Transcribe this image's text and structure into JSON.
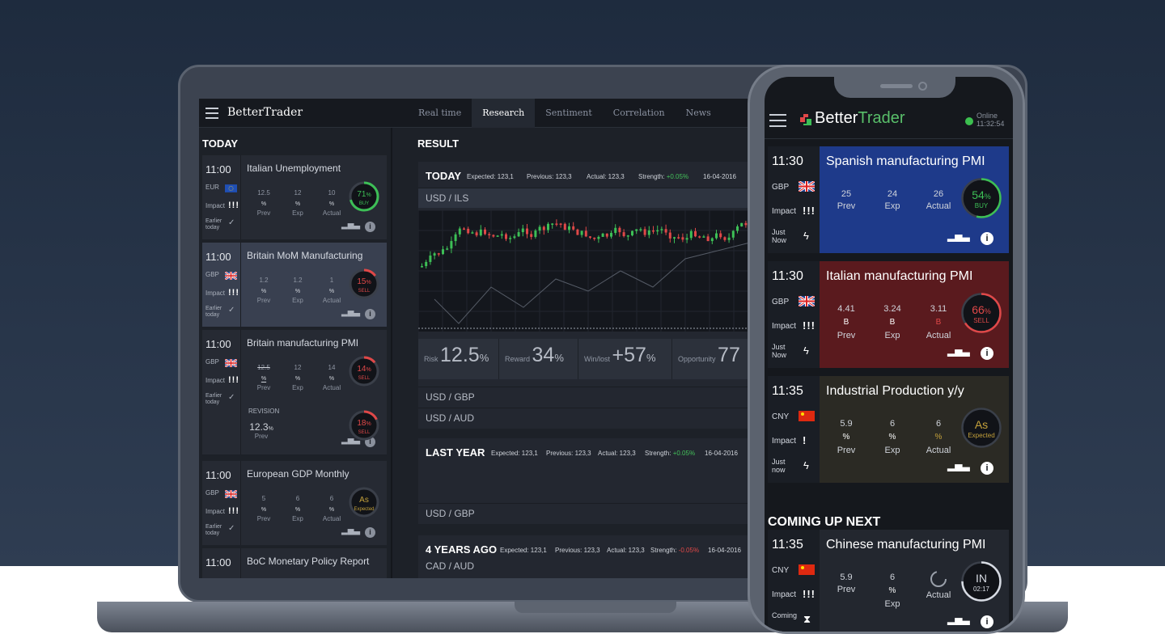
{
  "colors": {
    "buy": "#3dbf56",
    "sell": "#e04848",
    "expected": "#c4a13b",
    "card_blue": "#1e3a8a",
    "card_red": "#5a1a1e",
    "card_olive": "#2b2a24"
  },
  "desktop": {
    "logo": "BetterTrader",
    "tabs": [
      "Real time",
      "Research",
      "Sentiment",
      "Correlation",
      "News"
    ],
    "active_tab": "Research",
    "today_label": "TODAY",
    "result_label": "RESULT",
    "events": [
      {
        "time": "11:00",
        "currency": "EUR",
        "flag": "eu",
        "impact_label": "Impact",
        "impact": "!!!",
        "earlier": "Earlier today",
        "check": "✓",
        "title": "Italian Unemployment",
        "prev": "12.5",
        "exp": "12",
        "actual": "10",
        "unit": "%",
        "prev_label": "Prev",
        "exp_label": "Exp",
        "actual_label": "Actual",
        "ring_value": "71",
        "ring_unit": "%",
        "ring_label": "BUY",
        "ring_kind": "buy",
        "ring_fraction": 0.71
      },
      {
        "time": "11:00",
        "currency": "GBP",
        "flag": "uk",
        "impact_label": "Impact",
        "impact": "!!!",
        "earlier": "Earlier today",
        "check": "✓",
        "title": "Britain MoM Manufacturing",
        "prev": "1.2",
        "exp": "1.2",
        "actual": "1",
        "unit": "%",
        "prev_label": "Prev",
        "exp_label": "Exp",
        "actual_label": "Actual",
        "ring_value": "15",
        "ring_unit": "%",
        "ring_label": "SELL",
        "ring_kind": "sell",
        "ring_fraction": 0.15
      },
      {
        "time": "11:00",
        "currency": "GBP",
        "flag": "uk",
        "impact_label": "Impact",
        "impact": "!!!",
        "earlier": "Earlier today",
        "check": "✓",
        "title": "Britain manufacturing PMI",
        "prev": "12.5",
        "exp": "12",
        "actual": "14",
        "unit": "%",
        "prev_label": "Prev",
        "exp_label": "Exp",
        "actual_label": "Actual",
        "ring_value": "14",
        "ring_unit": "%",
        "ring_label": "SELL",
        "ring_kind": "sell",
        "ring_fraction": 0.14,
        "revision_label": "REVISION",
        "revision_prev": "12.3",
        "revision_ring_value": "18",
        "revision_ring_label": "SELL",
        "revision_ring_fraction": 0.18
      },
      {
        "time": "11:00",
        "currency": "GBP",
        "flag": "uk",
        "impact_label": "Impact",
        "impact": "!!!",
        "earlier": "Earlier today",
        "check": "✓",
        "title": "European GDP Monthly",
        "prev": "5",
        "exp": "6",
        "actual": "6",
        "unit": "%",
        "prev_label": "Prev",
        "exp_label": "Exp",
        "actual_label": "Actual",
        "ring_value": "As",
        "ring_label": "Expected",
        "ring_kind": "expected",
        "ring_fraction": 0
      },
      {
        "time": "11:00",
        "title": "BoC Monetary Policy Report"
      }
    ],
    "today_panel": {
      "title": "TODAY",
      "expected": "Expected: 123,1",
      "previous": "Previous: 123,3",
      "actual": "Actual: 123,3",
      "strength_label": "Strength:",
      "strength": "+0.05%",
      "date": "16-04-2016",
      "pair": "USD / ILS",
      "risk_label": "Risk",
      "risk": "12.5",
      "reward_label": "Reward",
      "reward": "34",
      "winlost_label": "Win/lost",
      "winlost": "+57",
      "opportunity_label": "Opportunity",
      "opportunity": "77",
      "pct": "%",
      "pairs": [
        "USD / GBP",
        "USD / AUD"
      ]
    },
    "last_year_panel": {
      "title": "LAST YEAR",
      "expected": "Expected: 123,1",
      "previous": "Previous: 123,3",
      "actual": "Actual: 123,3",
      "strength_label": "Strength:",
      "strength": "+0.05%",
      "date": "16-04-2016",
      "pair": "USD / GBP"
    },
    "years_ago_panel": {
      "title": "4 YEARS AGO",
      "expected": "Expected: 123,1",
      "previous": "Previous: 123,3",
      "actual": "Actual: 123,3",
      "strength_label": "Strength:",
      "strength": "-0.05%",
      "date": "16-04-2016",
      "pair": "CAD / AUD"
    }
  },
  "mobile": {
    "logo_a": "Better",
    "logo_b": "Trader",
    "status": "Online",
    "clock": "11:32:54",
    "coming_up": "COMING UP NEXT",
    "cards": [
      {
        "time": "11:30",
        "currency": "GBP",
        "flag": "uk",
        "impact_label": "Impact",
        "impact": "!!!",
        "just": "Just Now",
        "title": "Spanish manufacturing PMI",
        "prev": "25",
        "exp": "24",
        "actual": "26",
        "prev_unit": "",
        "exp_unit": "",
        "actual_unit": "",
        "prev_label": "Prev",
        "exp_label": "Exp",
        "actual_label": "Actual",
        "ring_value": "54",
        "ring_unit": "%",
        "ring_label": "BUY",
        "ring_kind": "buy",
        "ring_fraction": 0.54,
        "bg": "#1e3a8a"
      },
      {
        "time": "11:30",
        "currency": "GBP",
        "flag": "uk",
        "impact_label": "Impact",
        "impact": "!!!",
        "just": "Just Now",
        "title": "Italian manufacturing PMI",
        "prev": "4.41",
        "exp": "3.24",
        "actual": "3.11",
        "prev_unit": "B",
        "exp_unit": "B",
        "actual_unit": "B",
        "prev_label": "Prev",
        "exp_label": "Exp",
        "actual_label": "Actual",
        "ring_value": "66",
        "ring_unit": "%",
        "ring_label": "SELL",
        "ring_kind": "sell",
        "ring_fraction": 0.66,
        "bg": "#5a1a1e"
      },
      {
        "time": "11:35",
        "currency": "CNY",
        "flag": "cn",
        "impact_label": "Impact",
        "impact": "!",
        "just": "Just now",
        "title": "Industrial Production y/y",
        "prev": "5.9",
        "exp": "6",
        "actual": "6",
        "prev_unit": "%",
        "exp_unit": "%",
        "actual_unit": "%",
        "prev_label": "Prev",
        "exp_label": "Exp",
        "actual_label": "Actual",
        "ring_value": "As",
        "ring_unit": "",
        "ring_label": "Expected",
        "ring_kind": "expected",
        "ring_fraction": 0,
        "bg": "#2b2a24"
      },
      {
        "time": "11:35",
        "currency": "CNY",
        "flag": "cn",
        "impact_label": "Impact",
        "impact": "!!!",
        "just": "Coming",
        "title": "Chinese manufacturing PMI",
        "prev": "5.9",
        "exp": "6",
        "actual": "",
        "prev_unit": "",
        "exp_unit": "%",
        "actual_unit": "",
        "prev_label": "Prev",
        "exp_label": "Exp",
        "actual_label": "Actual",
        "ring_value": "IN",
        "ring_unit": "",
        "ring_label": "02:17",
        "ring_kind": "countdown",
        "ring_fraction": 0.75,
        "bg": "#23272f"
      }
    ]
  }
}
